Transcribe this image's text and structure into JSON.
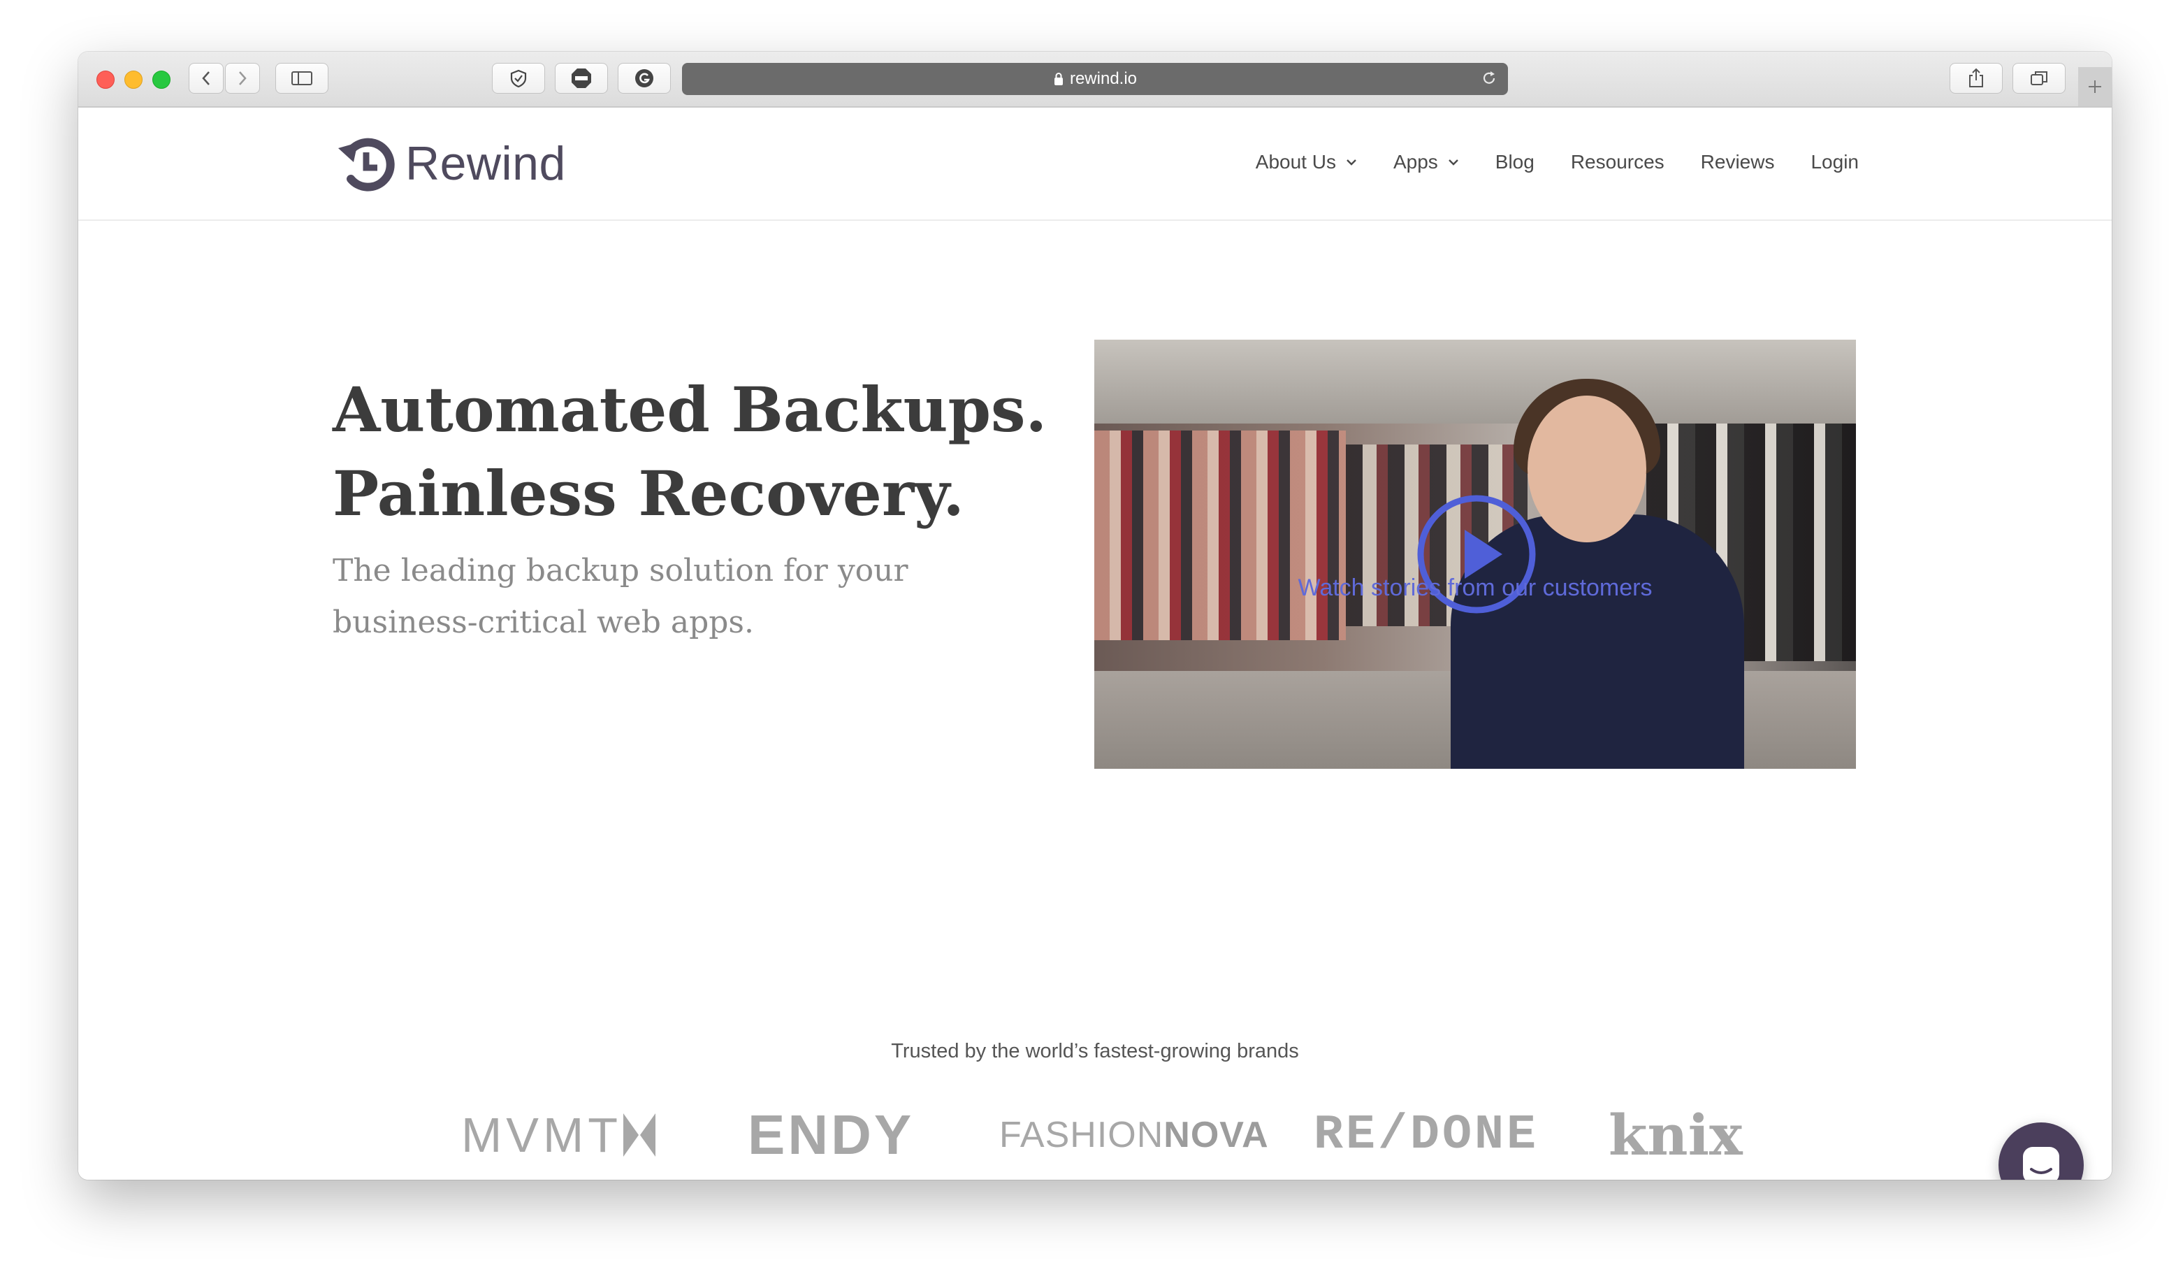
{
  "browser": {
    "url": "rewind.io"
  },
  "site": {
    "logo_text": "Rewind",
    "nav": [
      {
        "label": "About Us",
        "has_dropdown": true
      },
      {
        "label": "Apps",
        "has_dropdown": true
      },
      {
        "label": "Blog",
        "has_dropdown": false
      },
      {
        "label": "Resources",
        "has_dropdown": false
      },
      {
        "label": "Reviews",
        "has_dropdown": false
      },
      {
        "label": "Login",
        "has_dropdown": false
      }
    ]
  },
  "hero": {
    "title_line1": "Automated Backups.",
    "title_line2": "Painless Recovery.",
    "subtitle": "The leading backup solution for your business-critical web apps.",
    "video_link": "Watch stories from our customers"
  },
  "trusted": {
    "heading": "Trusted by the world’s fastest-growing brands",
    "brands": [
      "MVMT",
      "ENDY",
      "FASHION",
      "NOVA",
      "RE/DONE",
      "knix"
    ]
  },
  "colors": {
    "accent": "#5f6ad9",
    "logo": "#4f4a5e",
    "chat_button": "#4b3f5c"
  }
}
